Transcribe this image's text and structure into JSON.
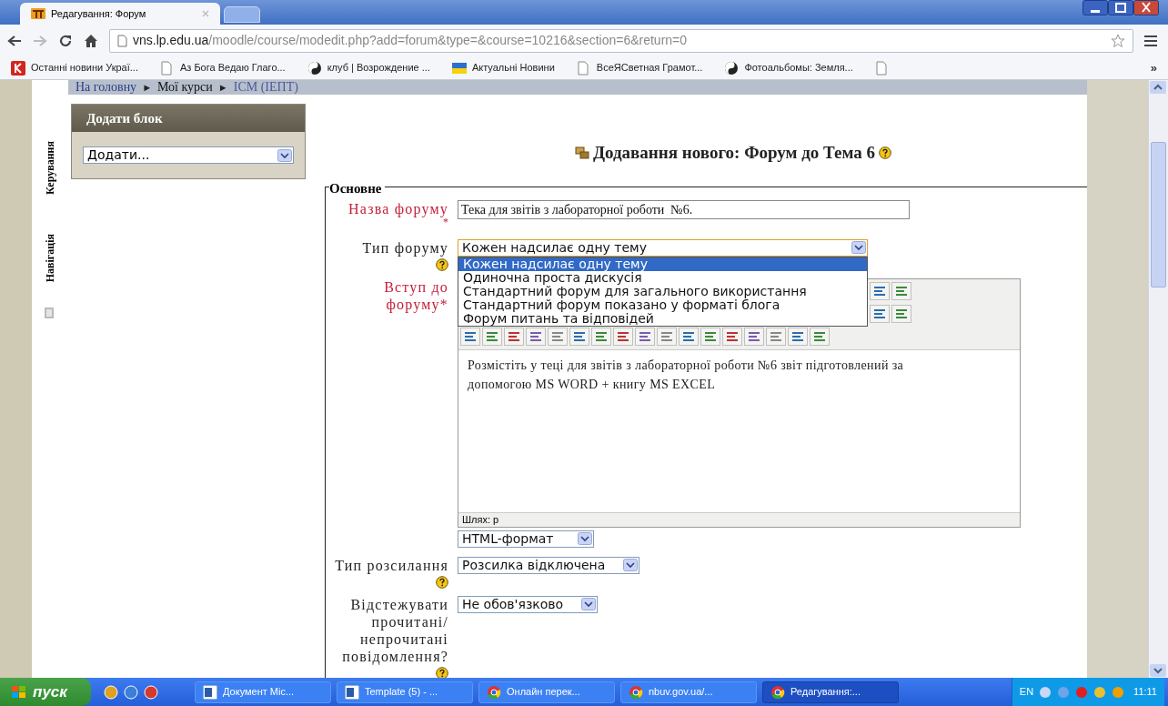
{
  "browser": {
    "tab_title": "Редагування: Форум",
    "url_host": "vns.lp.edu.ua",
    "url_path": "/moodle/course/modedit.php?add=forum&type=&course=10216&section=6&return=0",
    "bookmarks": [
      {
        "label": "Останні новини Украї...",
        "kind": "news"
      },
      {
        "label": "Аз Бога Ведаю Глаго...",
        "kind": "page"
      },
      {
        "label": "клуб | Возрождение ...",
        "kind": "globe"
      },
      {
        "label": "Актуальні Новини",
        "kind": "flag"
      },
      {
        "label": "ВсеЯСветная Грамот...",
        "kind": "page"
      },
      {
        "label": "Фотоальбомы: Земля...",
        "kind": "globe"
      },
      {
        "kind": "page"
      }
    ],
    "more": "»"
  },
  "breadcrumb": {
    "items": [
      "На головну",
      "Мої курси",
      "ІСМ (ІЕПТ)"
    ],
    "separator": "►"
  },
  "side_tabs": [
    {
      "label": "Керування"
    },
    {
      "label": "Навігація"
    }
  ],
  "add_block": {
    "title": "Додати блок",
    "select_value": "Додати..."
  },
  "heading": "Додавання нового: Форум до Тема 6",
  "fieldset": {
    "legend": "Основне",
    "fields": [
      {
        "kind": "text",
        "label": "Назва форуму",
        "required": true,
        "asterisk": "*",
        "value": "Тека для звітів з лабораторної роботи  №6."
      },
      {
        "kind": "select",
        "label": "Тип форуму",
        "required": false,
        "help": true,
        "value": "Кожен надсилає одну тему",
        "open": true,
        "options": [
          {
            "label": "Кожен надсилає одну тему",
            "selected": true
          },
          {
            "label": "Одиночна проста дискусія",
            "selected": false
          },
          {
            "label": "Стандартний форум для загального використання",
            "selected": false
          },
          {
            "label": "Стандартний форум показано у форматі блога",
            "selected": false
          },
          {
            "label": "Форум питань та відповідей",
            "selected": false
          }
        ]
      },
      {
        "kind": "editor",
        "label": "Вступ до форуму",
        "required": true,
        "asterisk": "*",
        "content": "Розмістіть у теці для звітів з лабораторної роботи №6 звіт підготовлений за допомогою MS WORD + книгу MS EXCEL",
        "path": "Шлях: p",
        "format": "HTML-формат"
      },
      {
        "kind": "select",
        "label": "Тип розсилання",
        "required": false,
        "help": true,
        "value": "Розсилка відключена"
      },
      {
        "kind": "select",
        "label": "Відстежувати прочитані/ непрочитані повідомлення?",
        "required": false,
        "help": true,
        "value": "Не обов'язково"
      }
    ]
  },
  "taskbar": {
    "start": "пуск",
    "items": [
      {
        "label": "Документ Mic...",
        "kind": "word",
        "active": false
      },
      {
        "label": "Template (5) - ...",
        "kind": "word",
        "active": false
      },
      {
        "label": "Онлайн перек...",
        "kind": "chrome",
        "active": false
      },
      {
        "label": "nbuv.gov.ua/...",
        "kind": "chrome",
        "active": false
      },
      {
        "label": "Редагування:...",
        "kind": "chrome",
        "active": true
      }
    ],
    "language": "EN",
    "time": "11:11"
  }
}
